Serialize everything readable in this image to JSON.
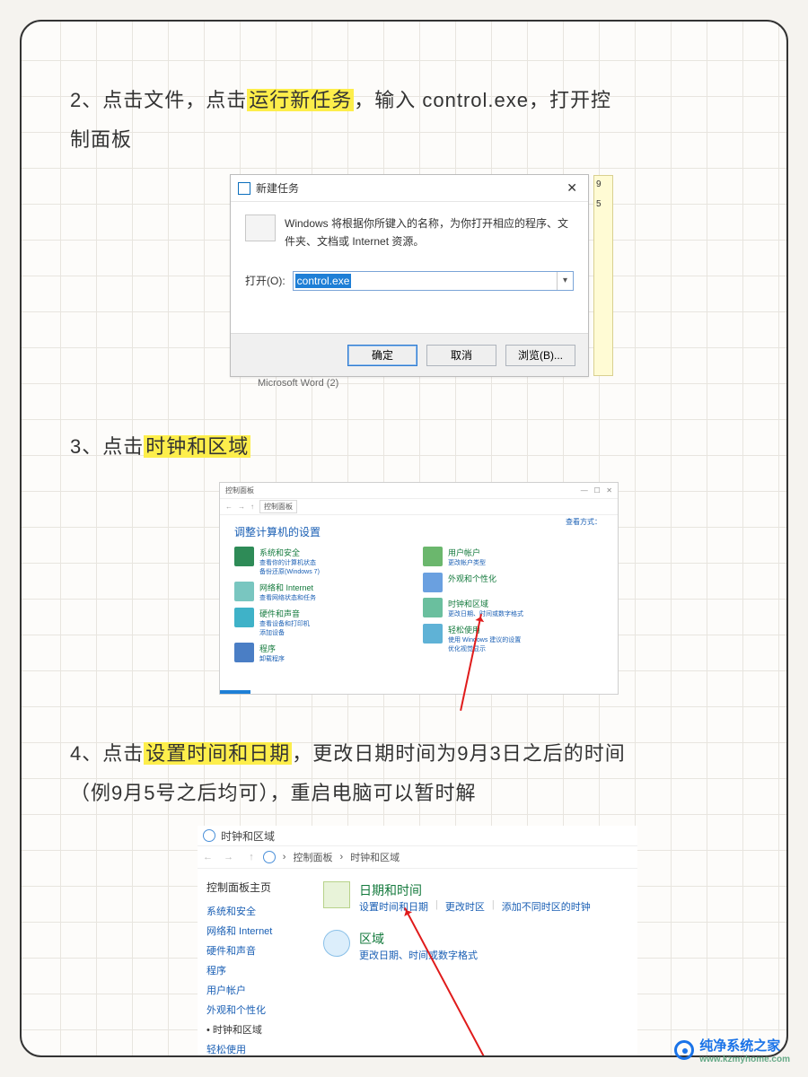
{
  "step2": {
    "prefix": "2、点击文件，点击",
    "hl": "运行新任务",
    "mid": "，输入 control.exe，打开控",
    "line2": "制面板"
  },
  "dlg": {
    "title": "新建任务",
    "desc": "Windows 将根据你所键入的名称，为你打开相应的程序、文件夹、文档或 Internet 资源。",
    "open_label": "打开(O):",
    "value": "control.exe",
    "ok": "确定",
    "cancel": "取消",
    "browse": "浏览(B)...",
    "bg1": "9",
    "bg2": "5",
    "bg_word": "Microsoft Word (2)"
  },
  "step3": {
    "prefix": "3、点击",
    "hl": "时钟和区域"
  },
  "cp": {
    "title": "控制面板",
    "path": "控制面板",
    "heading": "调整计算机的设置",
    "view": "查看方式：",
    "left": [
      {
        "t": "系统和安全",
        "d": "查看你的计算机状态",
        "d2": "备份还原(Windows 7)"
      },
      {
        "t": "网络和 Internet",
        "d": "查看网络状态和任务"
      },
      {
        "t": "硬件和声音",
        "d": "查看设备和打印机",
        "d2": "添加设备"
      },
      {
        "t": "程序",
        "d": "卸载程序"
      }
    ],
    "right": [
      {
        "t": "用户帐户",
        "d": "更改帐户类型"
      },
      {
        "t": "外观和个性化"
      },
      {
        "t": "时钟和区域",
        "d": "更改日期、时间或数字格式"
      },
      {
        "t": "轻松使用",
        "d": "使用 Windows 建议的设置",
        "d2": "优化视觉显示"
      }
    ]
  },
  "step4": {
    "prefix": "4、点击",
    "hl": "设置时间和日期",
    "rest1": "，更改日期时间为9月3日之后的时间",
    "line2": "（例9月5号之后均可），重启电脑可以暂时解"
  },
  "cr": {
    "title": "时钟和区域",
    "crumb1": "控制面板",
    "crumb2": "时钟和区域",
    "side_hd": "控制面板主页",
    "side": [
      "系统和安全",
      "网络和 Internet",
      "硬件和声音",
      "程序",
      "用户帐户",
      "外观和个性化"
    ],
    "side_current": "时钟和区域",
    "side_last": "轻松使用",
    "row1": {
      "title": "日期和时间",
      "a": "设置时间和日期",
      "b": "更改时区",
      "c": "添加不同时区的时钟"
    },
    "row2": {
      "title": "区域",
      "a": "更改日期、时间或数字格式"
    }
  },
  "wm": {
    "name": "纯净系统之家",
    "url": "www.kzmyhome.com"
  }
}
